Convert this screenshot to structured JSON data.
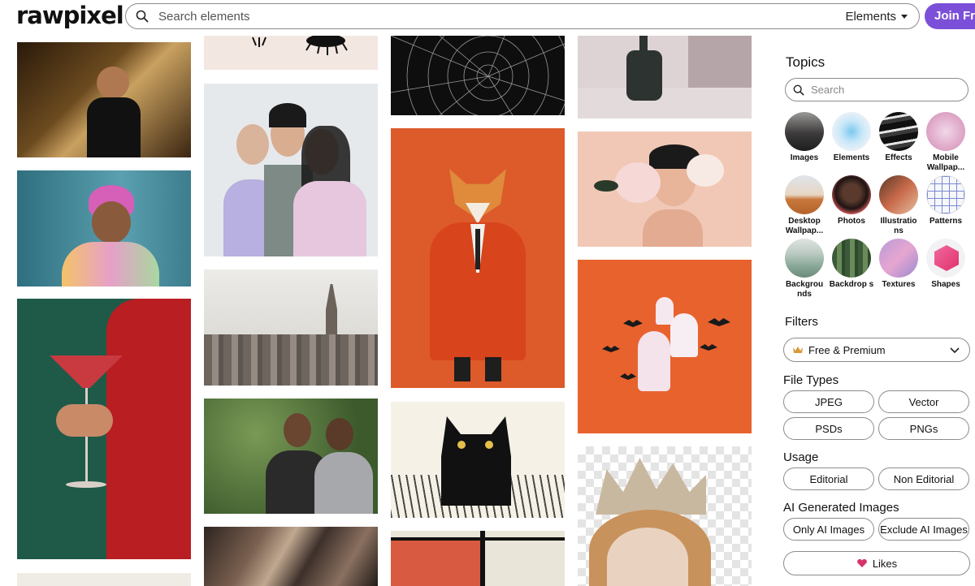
{
  "header": {
    "logo": "rawpixel",
    "search_placeholder": "Search elements",
    "search_scope": "Elements",
    "join_label": "Join Fre"
  },
  "colors": {
    "accent": "#7b4fd8",
    "heart": "#d6336c",
    "crown": "#d89a3a"
  },
  "sidebar": {
    "topics_title": "Topics",
    "topics_search_placeholder": "Search",
    "topics": [
      {
        "label": "Images"
      },
      {
        "label": "Elements"
      },
      {
        "label": "Effects"
      },
      {
        "label": "Mobile Wallpap..."
      },
      {
        "label": "Desktop Wallpap..."
      },
      {
        "label": "Photos"
      },
      {
        "label": "Illustratio ns"
      },
      {
        "label": "Patterns"
      },
      {
        "label": "Backgrou nds"
      },
      {
        "label": "Backdrop s"
      },
      {
        "label": "Textures"
      },
      {
        "label": "Shapes"
      }
    ],
    "filters_title": "Filters",
    "license_value": "Free & Premium",
    "file_types_title": "File Types",
    "file_types": [
      "JPEG",
      "Vector",
      "PSDs",
      "PNGs"
    ],
    "usage_title": "Usage",
    "usage": [
      "Editorial",
      "Non Editorial"
    ],
    "ai_title": "AI Generated Images",
    "ai_options": [
      "Only AI Images",
      "Exclude AI Images"
    ],
    "likes_label": "Likes"
  }
}
